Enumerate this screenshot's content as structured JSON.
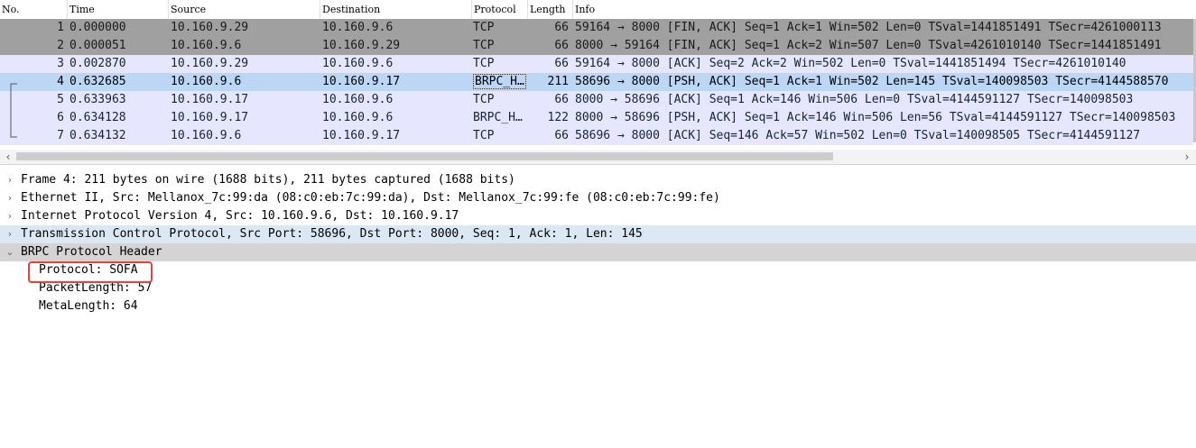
{
  "columns": {
    "no": "No.",
    "time": "Time",
    "source": "Source",
    "destination": "Destination",
    "protocol": "Protocol",
    "length": "Length",
    "info": "Info"
  },
  "packets": [
    {
      "no": "1",
      "time": "0.000000",
      "src": "10.160.9.29",
      "dst": "10.160.9.6",
      "proto": "TCP",
      "len": "66",
      "info": "59164 → 8000 [FIN, ACK] Seq=1 Ack=1 Win=502 Len=0 TSval=1441851491 TSecr=4261000113"
    },
    {
      "no": "2",
      "time": "0.000051",
      "src": "10.160.9.6",
      "dst": "10.160.9.29",
      "proto": "TCP",
      "len": "66",
      "info": "8000 → 59164 [FIN, ACK] Seq=1 Ack=2 Win=507 Len=0 TSval=4261010140 TSecr=1441851491"
    },
    {
      "no": "3",
      "time": "0.002870",
      "src": "10.160.9.29",
      "dst": "10.160.9.6",
      "proto": "TCP",
      "len": "66",
      "info": "59164 → 8000 [ACK] Seq=2 Ack=2 Win=502 Len=0 TSval=1441851494 TSecr=4261010140"
    },
    {
      "no": "4",
      "time": "0.632685",
      "src": "10.160.9.6",
      "dst": "10.160.9.17",
      "proto": "BRPC_H…",
      "len": "211",
      "info": "58696 → 8000 [PSH, ACK] Seq=1 Ack=1 Win=502 Len=145 TSval=140098503 TSecr=4144588570"
    },
    {
      "no": "5",
      "time": "0.633963",
      "src": "10.160.9.17",
      "dst": "10.160.9.6",
      "proto": "TCP",
      "len": "66",
      "info": "8000 → 58696 [ACK] Seq=1 Ack=146 Win=506 Len=0 TSval=4144591127 TSecr=140098503"
    },
    {
      "no": "6",
      "time": "0.634128",
      "src": "10.160.9.17",
      "dst": "10.160.9.6",
      "proto": "BRPC_H…",
      "len": "122",
      "info": "8000 → 58696 [PSH, ACK] Seq=1 Ack=146 Win=506 Len=56 TSval=4144591127 TSecr=140098503"
    },
    {
      "no": "7",
      "time": "0.634132",
      "src": "10.160.9.6",
      "dst": "10.160.9.17",
      "proto": "TCP",
      "len": "66",
      "info": "58696 → 8000 [ACK] Seq=146 Ack=57 Win=502 Len=0 TSval=140098505 TSecr=4144591127"
    }
  ],
  "details": {
    "frame": "Frame 4: 211 bytes on wire (1688 bits), 211 bytes captured (1688 bits)",
    "ethernet": "Ethernet II, Src: Mellanox_7c:99:da (08:c0:eb:7c:99:da), Dst: Mellanox_7c:99:fe (08:c0:eb:7c:99:fe)",
    "ip": "Internet Protocol Version 4, Src: 10.160.9.6, Dst: 10.160.9.17",
    "tcp": "Transmission Control Protocol, Src Port: 58696, Dst Port: 8000, Seq: 1, Ack: 1, Len: 145",
    "brpc": "BRPC Protocol Header",
    "brpc_fields": [
      "Protocol: SOFA",
      "PacketLength: 57",
      "MetaLength: 64"
    ]
  },
  "colors": {
    "fin_row": "#a0a0a0",
    "tcp_row": "#e7e6ff",
    "selected_row": "#bcd6f6",
    "highlight_box": "#e8413c"
  },
  "icons": {
    "collapsed": "chevron-right-icon",
    "expanded": "chevron-down-icon",
    "scroll_left": "chevron-left-icon",
    "scroll_right": "chevron-right-icon"
  }
}
